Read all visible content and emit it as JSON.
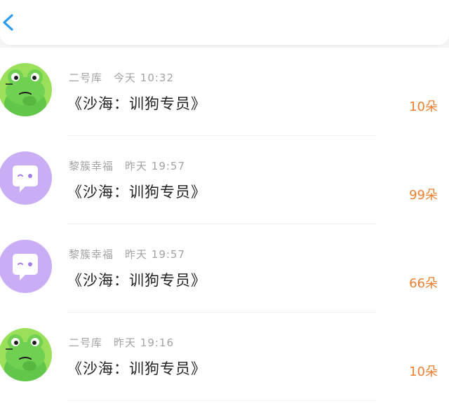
{
  "header": {
    "back_icon": "chevron-left-icon"
  },
  "colors": {
    "accent": "#2a9af2",
    "amount": "#ef7f2f",
    "meta": "#a3a3a3",
    "title": "#222222"
  },
  "records": [
    {
      "avatar": "frog-avatar",
      "user": "二号库",
      "time": "今天 10:32",
      "title": "《沙海：训狗专员》",
      "amount": "10朵"
    },
    {
      "avatar": "chat-bubble-avatar",
      "user": "黎簇幸福",
      "time": "昨天 19:57",
      "title": "《沙海：训狗专员》",
      "amount": "99朵"
    },
    {
      "avatar": "chat-bubble-avatar",
      "user": "黎簇幸福",
      "time": "昨天 19:57",
      "title": "《沙海：训狗专员》",
      "amount": "66朵"
    },
    {
      "avatar": "frog-avatar",
      "user": "二号库",
      "time": "昨天 19:16",
      "title": "《沙海：训狗专员》",
      "amount": "10朵"
    }
  ]
}
